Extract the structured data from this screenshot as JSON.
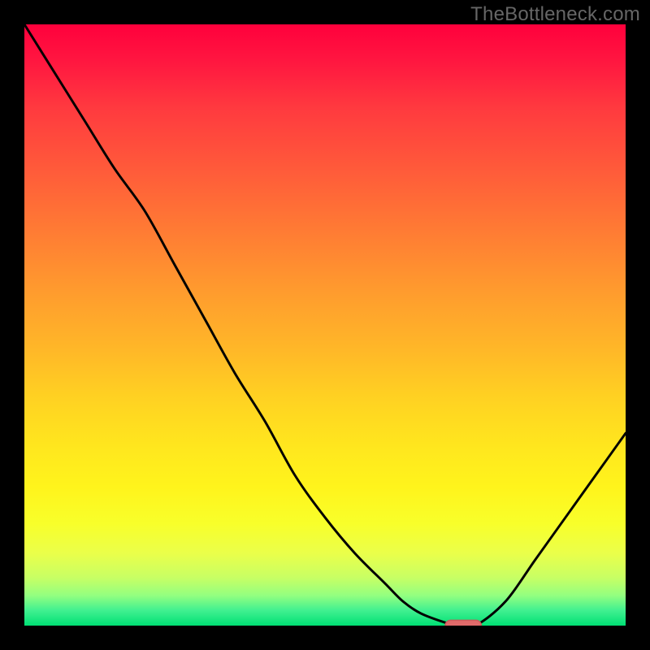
{
  "watermark": {
    "text": "TheBottleneck.com"
  },
  "colors": {
    "page_bg": "#000000",
    "curve_stroke": "#000000",
    "marker_fill": "#e06a6a",
    "marker_stroke": "#cc5a5a",
    "watermark_text": "#666666"
  },
  "chart_data": {
    "type": "line",
    "title": "",
    "xlabel": "",
    "ylabel": "",
    "x": [
      0.0,
      0.05,
      0.1,
      0.15,
      0.2,
      0.25,
      0.3,
      0.35,
      0.4,
      0.45,
      0.5,
      0.55,
      0.6,
      0.63,
      0.66,
      0.7,
      0.72,
      0.75,
      0.8,
      0.85,
      0.9,
      0.95,
      1.0
    ],
    "values": [
      1.0,
      0.92,
      0.84,
      0.76,
      0.69,
      0.6,
      0.51,
      0.42,
      0.34,
      0.25,
      0.18,
      0.12,
      0.07,
      0.04,
      0.02,
      0.005,
      0.0,
      0.0,
      0.04,
      0.11,
      0.18,
      0.25,
      0.32
    ],
    "minimum": {
      "x": 0.73,
      "y": 0.0
    },
    "xlim": [
      0,
      1
    ],
    "ylim": [
      0,
      1
    ],
    "legend": []
  }
}
